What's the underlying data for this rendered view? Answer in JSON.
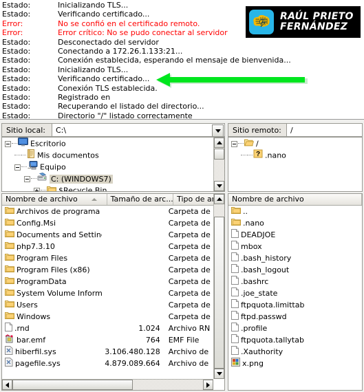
{
  "log": {
    "entries": [
      {
        "type": "Estado:",
        "msg": "Inicializando TLS...",
        "level": "status"
      },
      {
        "type": "Estado:",
        "msg": "Verificando certificado...",
        "level": "status"
      },
      {
        "type": "Error:",
        "msg": "No se confió en el certificado remoto.",
        "level": "error"
      },
      {
        "type": "Error:",
        "msg": "Error crítico: No se pudo conectar al servidor",
        "level": "error"
      },
      {
        "type": "Estado:",
        "msg": "Desconectado del servidor",
        "level": "status"
      },
      {
        "type": "Estado:",
        "msg": "Conectando a 172.26.1.133:21...",
        "level": "status"
      },
      {
        "type": "Estado:",
        "msg": "Conexión establecida, esperando el mensaje de bienvenida...",
        "level": "status"
      },
      {
        "type": "Estado:",
        "msg": "Inicializando TLS...",
        "level": "status"
      },
      {
        "type": "Estado:",
        "msg": "Verificando certificado...",
        "level": "status"
      },
      {
        "type": "Estado:",
        "msg": "Conexión TLS establecida.",
        "level": "status"
      },
      {
        "type": "Estado:",
        "msg": "Registrado en",
        "level": "status"
      },
      {
        "type": "Estado:",
        "msg": "Recuperando el listado del directorio...",
        "level": "status"
      },
      {
        "type": "Estado:",
        "msg": "Directorio \"/\" listado correctamente",
        "level": "status"
      }
    ]
  },
  "logo": {
    "line1": "RAÚL PRIETO",
    "line2": "FERNÁNDEZ",
    "badge_color": "#29b6e8",
    "brain_color": "#f5b800",
    "bg_color": "#000000"
  },
  "annotation": {
    "arrow_color": "#00e61e",
    "direction": "left",
    "points_at": "Verificando certificado..."
  },
  "local": {
    "path_label": "Sitio local:",
    "path_value": "C:\\",
    "tree": [
      {
        "label": "Escritorio",
        "icon": "desktop-icon",
        "indent": 0,
        "expander": "minus",
        "selected": false
      },
      {
        "label": "Mis documentos",
        "icon": "documents-icon",
        "indent": 1,
        "expander": "none",
        "selected": false
      },
      {
        "label": "Equipo",
        "icon": "computer-icon",
        "indent": 1,
        "expander": "minus",
        "selected": false
      },
      {
        "label": "C: (WINDOWS7)",
        "icon": "drive-icon",
        "indent": 2,
        "expander": "minus",
        "selected": true
      },
      {
        "label": "$Recycle.Bin",
        "icon": "folder-icon",
        "indent": 3,
        "expander": "plus",
        "selected": false
      }
    ],
    "columns": [
      "Nombre de archivo",
      "Tamaño de arc...",
      "Tipo de arc"
    ],
    "sorted_column": "Nombre de archivo",
    "files": [
      {
        "name": "Archivos de programa",
        "size": "",
        "type": "Carpeta de",
        "icon": "folder-icon"
      },
      {
        "name": "Config.Msi",
        "size": "",
        "type": "Carpeta de",
        "icon": "folder-icon"
      },
      {
        "name": "Documents and Settings",
        "size": "",
        "type": "Carpeta de",
        "icon": "folder-icon"
      },
      {
        "name": "php7.3.10",
        "size": "",
        "type": "Carpeta de",
        "icon": "folder-icon"
      },
      {
        "name": "Program Files",
        "size": "",
        "type": "Carpeta de",
        "icon": "folder-icon"
      },
      {
        "name": "Program Files (x86)",
        "size": "",
        "type": "Carpeta de",
        "icon": "folder-icon"
      },
      {
        "name": "ProgramData",
        "size": "",
        "type": "Carpeta de",
        "icon": "folder-icon"
      },
      {
        "name": "System Volume Informa...",
        "size": "",
        "type": "Carpeta de",
        "icon": "folder-icon"
      },
      {
        "name": "Users",
        "size": "",
        "type": "Carpeta de",
        "icon": "folder-icon"
      },
      {
        "name": "Windows",
        "size": "",
        "type": "Carpeta de",
        "icon": "folder-icon"
      },
      {
        "name": ".rnd",
        "size": "1.024",
        "type": "Archivo RN",
        "icon": "file-icon"
      },
      {
        "name": "bar.emf",
        "size": "764",
        "type": "EMF File",
        "icon": "emf-icon"
      },
      {
        "name": "hiberfil.sys",
        "size": "3.106.480.128",
        "type": "Archivo de",
        "icon": "sys-icon"
      },
      {
        "name": "pagefile.sys",
        "size": "4.879.089.664",
        "type": "Archivo de",
        "icon": "sys-icon"
      }
    ]
  },
  "remote": {
    "path_label": "Sitio remoto:",
    "path_value": "/",
    "tree": [
      {
        "label": "/",
        "icon": "folder-open-icon",
        "indent": 0,
        "expander": "minus",
        "selected": false
      },
      {
        "label": ".nano",
        "icon": "unknown-folder-icon",
        "indent": 1,
        "expander": "none",
        "selected": false
      }
    ],
    "columns": [
      "Nombre de archivo"
    ],
    "files": [
      {
        "name": "..",
        "icon": "folder-icon"
      },
      {
        "name": ".nano",
        "icon": "folder-icon"
      },
      {
        "name": "DEADJOE",
        "icon": "file-icon"
      },
      {
        "name": "mbox",
        "icon": "file-icon"
      },
      {
        "name": ".bash_history",
        "icon": "file-icon"
      },
      {
        "name": ".bash_logout",
        "icon": "file-icon"
      },
      {
        "name": ".bashrc",
        "icon": "file-icon"
      },
      {
        "name": ".joe_state",
        "icon": "file-icon"
      },
      {
        "name": "ftpquota.limittab",
        "icon": "file-icon"
      },
      {
        "name": "ftpd.passwd",
        "icon": "file-icon"
      },
      {
        "name": ".profile",
        "icon": "file-icon"
      },
      {
        "name": "ftpquota.tallytab",
        "icon": "file-icon"
      },
      {
        "name": ".Xauthority",
        "icon": "file-icon"
      },
      {
        "name": "x.png",
        "icon": "image-icon"
      }
    ]
  }
}
